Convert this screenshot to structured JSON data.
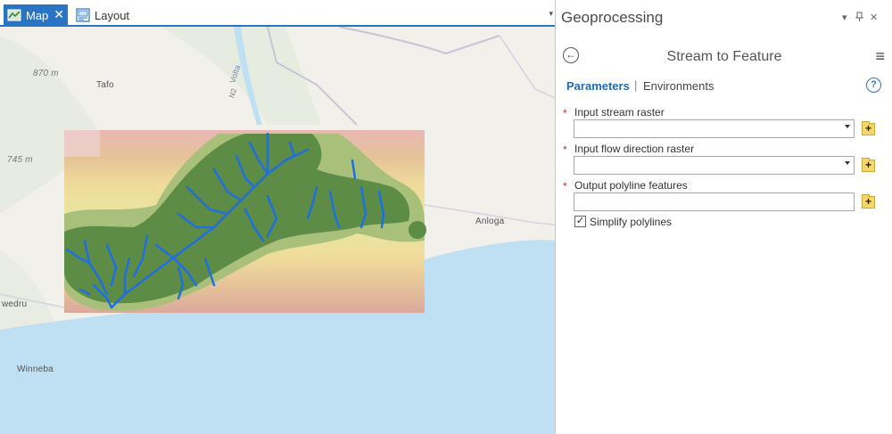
{
  "tabs": [
    {
      "label": "Map",
      "active": true,
      "icon": "map-icon"
    },
    {
      "label": "Layout",
      "active": false,
      "icon": "layout-icon"
    }
  ],
  "map": {
    "place_labels": [
      "Tafo",
      "Anloga",
      "Winneba",
      "wedru"
    ],
    "elevation_labels": [
      "870 m",
      "745 m"
    ],
    "road_label": "Volta",
    "road_shield": "N2",
    "colors": {
      "sea": "#bfe0f2",
      "land": "#f1f0eb",
      "river": "#1f6fe0",
      "stream_fill": "#5c8c45",
      "buffer": "#a8c07a"
    }
  },
  "geoprocessing": {
    "pane_title": "Geoprocessing",
    "tool_title": "Stream to Feature",
    "tab_parameters": "Parameters",
    "tab_separator": "|",
    "tab_environments": "Environments",
    "help_glyph": "?",
    "required_marker": "*",
    "params": [
      {
        "label": "Input stream raster",
        "type": "dropdown",
        "value": "",
        "required": true
      },
      {
        "label": "Input flow direction raster",
        "type": "dropdown",
        "value": "",
        "required": true
      },
      {
        "label": "Output polyline features",
        "type": "text",
        "value": "",
        "required": true
      }
    ],
    "simplify": {
      "label": "Simplify polylines",
      "checked": true
    },
    "accent_color": "#1b6cb8"
  }
}
